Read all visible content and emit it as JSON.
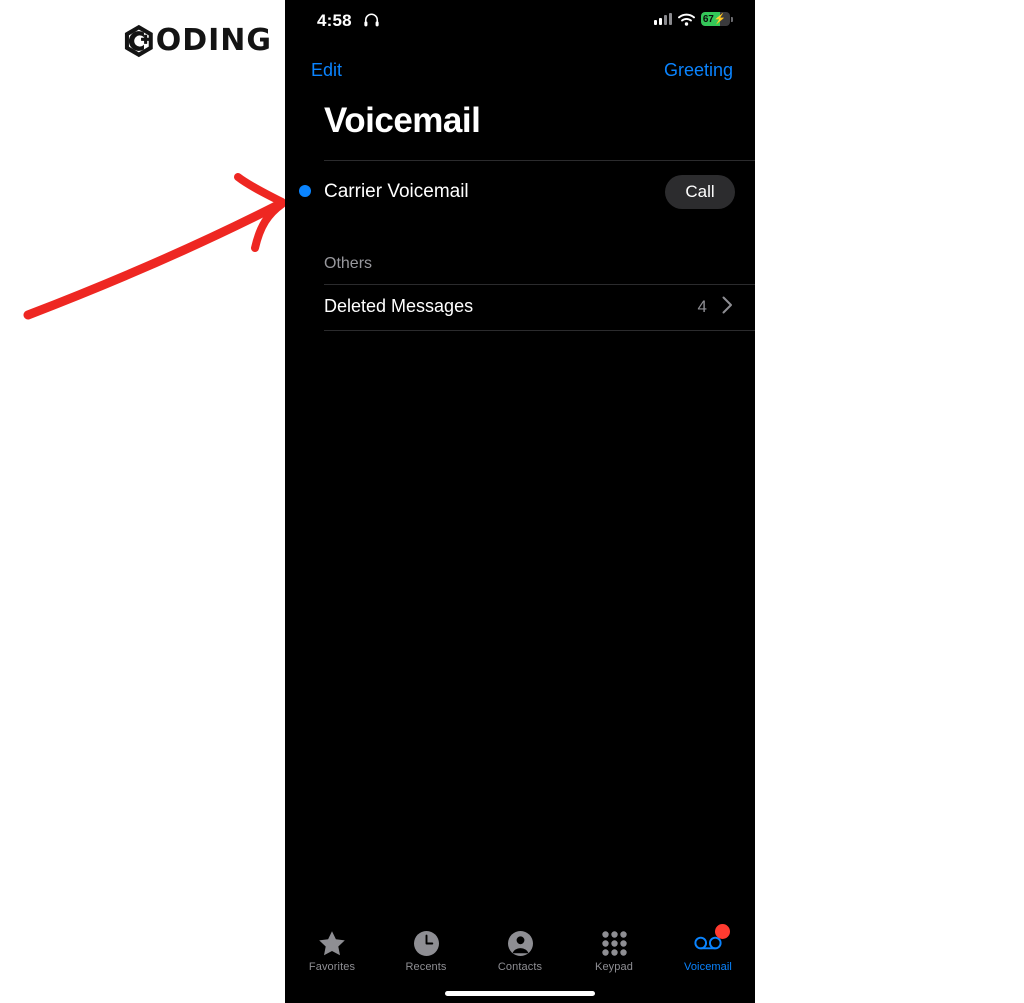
{
  "brand": {
    "logo_word": "ODING",
    "logo_mark_name": "c-plus-hexagon-logo",
    "full_name": "CODING",
    "color": "#141414"
  },
  "annotation": {
    "type": "hand-drawn-arrow",
    "color": "#ee2722",
    "points_to": "unread-dot"
  },
  "colors": {
    "accent_blue": "#0a84ff",
    "screen_bg": "#000000",
    "secondary_text": "#8e8e93",
    "pill_bg": "#2c2c2e",
    "badge_red": "#ff3b30",
    "battery_green": "#34c759"
  },
  "status_bar": {
    "time": "4:58",
    "headphones_icon": "headphones-icon",
    "signal_icon": "cellular-signal-icon",
    "signal_bars_active": 2,
    "signal_bars_total": 4,
    "wifi_icon": "wifi-icon",
    "battery_percent": "67",
    "battery_charging": true,
    "battery_icon": "battery-charging-icon"
  },
  "nav": {
    "edit_label": "Edit",
    "greeting_label": "Greeting"
  },
  "header": {
    "title": "Voicemail"
  },
  "voicemail_list": [
    {
      "name": "Carrier Voicemail",
      "unread": true,
      "action_label": "Call"
    }
  ],
  "others_section": {
    "header": "Others",
    "rows": [
      {
        "label": "Deleted Messages",
        "count": "4",
        "chevron_icon": "chevron-right-icon"
      }
    ]
  },
  "tab_bar": {
    "items": [
      {
        "label": "Favorites",
        "icon": "star-icon",
        "active": false,
        "badge": null
      },
      {
        "label": "Recents",
        "icon": "clock-icon",
        "active": false,
        "badge": null
      },
      {
        "label": "Contacts",
        "icon": "person-circle-icon",
        "active": false,
        "badge": null
      },
      {
        "label": "Keypad",
        "icon": "keypad-grid-icon",
        "active": false,
        "badge": null
      },
      {
        "label": "Voicemail",
        "icon": "voicemail-reels-icon",
        "active": true,
        "badge": "dot"
      }
    ]
  }
}
